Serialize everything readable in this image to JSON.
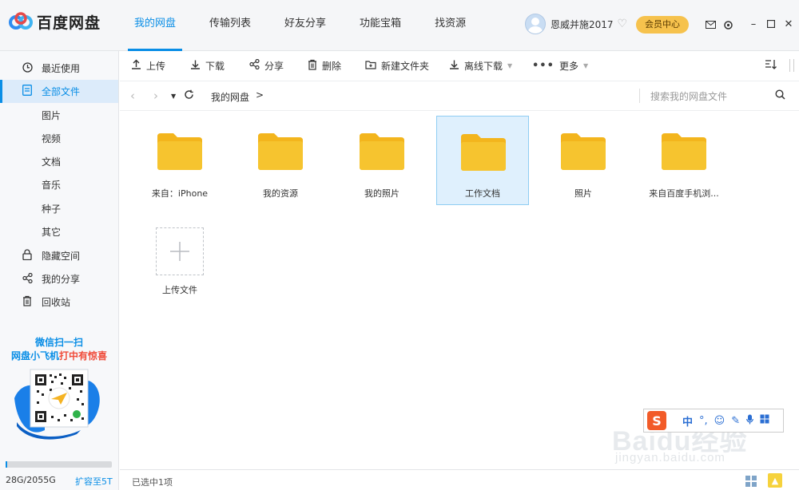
{
  "app": {
    "title": "百度网盘"
  },
  "nav": {
    "tabs": [
      {
        "label": "我的网盘",
        "active": true
      },
      {
        "label": "传输列表",
        "active": false
      },
      {
        "label": "好友分享",
        "active": false
      },
      {
        "label": "功能宝箱",
        "active": false
      },
      {
        "label": "找资源",
        "active": false
      }
    ]
  },
  "user": {
    "name": "恩威并施2017",
    "vip_label": "会员中心"
  },
  "sidebar": {
    "items": [
      {
        "label": "最近使用",
        "icon": "clock-icon"
      },
      {
        "label": "全部文件",
        "icon": "file-icon",
        "active": true
      },
      {
        "label": "图片"
      },
      {
        "label": "视频"
      },
      {
        "label": "文档"
      },
      {
        "label": "音乐"
      },
      {
        "label": "种子"
      },
      {
        "label": "其它"
      },
      {
        "label": "隐藏空间",
        "icon": "lock-icon"
      },
      {
        "label": "我的分享",
        "icon": "share-icon"
      },
      {
        "label": "回收站",
        "icon": "trash-icon"
      }
    ],
    "promo_line1": "微信扫一扫",
    "promo_line2_a": "网盘小飞机",
    "promo_line2_b": "打中有惊喜",
    "storage_text": "28G/2055G",
    "storage_used_fraction": 0.0136,
    "expand_label": "扩容至5T"
  },
  "toolbar": {
    "upload": "上传",
    "download": "下载",
    "share": "分享",
    "delete": "删除",
    "new_folder": "新建文件夹",
    "offline_download": "离线下载",
    "more": "更多"
  },
  "addressbar": {
    "crumb": "我的网盘",
    "separator": ">",
    "search_placeholder": "搜索我的网盘文件"
  },
  "folders": [
    {
      "name": "来自：iPhone"
    },
    {
      "name": "我的资源"
    },
    {
      "name": "我的照片"
    },
    {
      "name": "工作文档",
      "selected": true
    },
    {
      "name": "照片"
    },
    {
      "name": "来自百度手机浏..."
    }
  ],
  "upload_tile": {
    "label": "上传文件"
  },
  "status": {
    "text": "已选中1项"
  },
  "ime": {
    "mode": "中"
  },
  "watermark": {
    "line1": "Baidu经验",
    "line2": "jingyan.baidu.com"
  },
  "colors": {
    "accent": "#0a8ee6",
    "folder": "#f6c42f",
    "vip": "#f6c24d",
    "selected_bg": "#dff0fd"
  }
}
